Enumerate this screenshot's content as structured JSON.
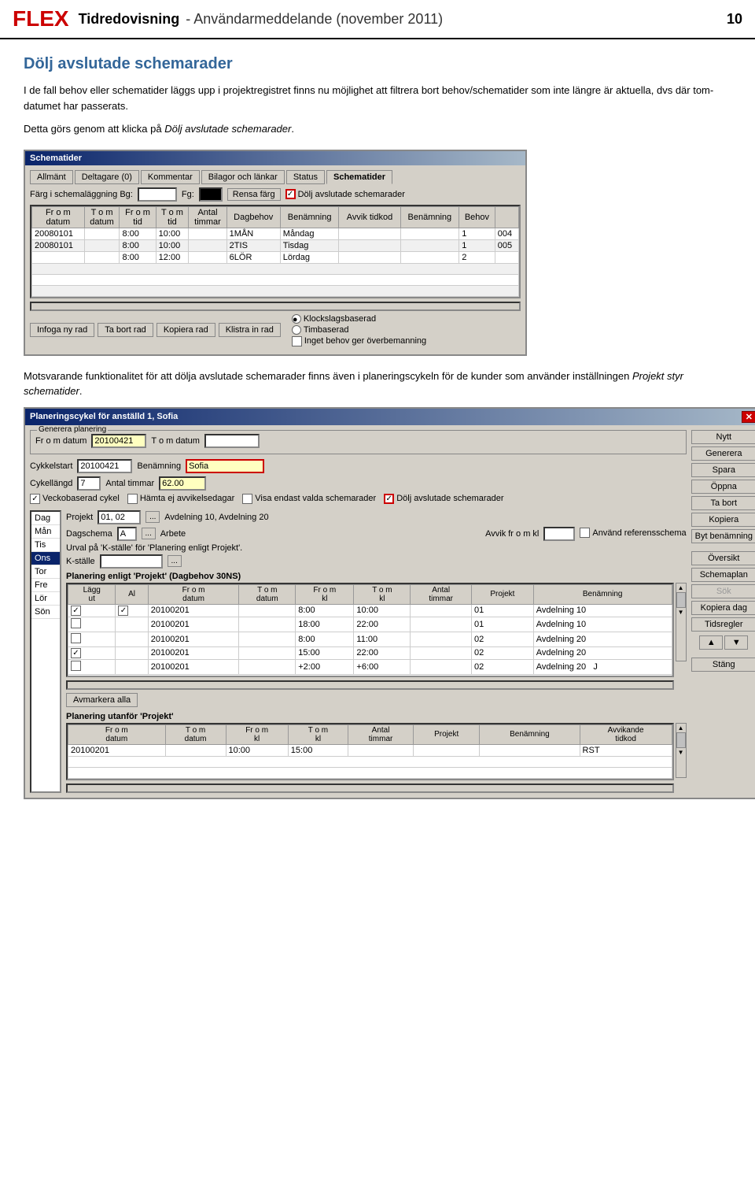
{
  "header": {
    "logo": "FLEX",
    "title": "Tidredovisning",
    "subtitle": "- Användarmeddelande (november 2011)",
    "page": "10"
  },
  "section1": {
    "title": "Dölj avslutade schemarader",
    "para1": "I de fall behov eller schematider läggs upp i projektregistret finns nu möjlighet att filtrera bort behov/schematider som inte längre är aktuella, dvs där tom-datumet har passerats.",
    "para2_prefix": "Detta görs genom att klicka på ",
    "para2_italic": "Dölj avslutade schemarader",
    "para2_suffix": "."
  },
  "schemaWindow": {
    "tabs": [
      "Allmänt",
      "Deltagare (0)",
      "Kommentar",
      "Bilagor och länkar",
      "Status",
      "Schematider"
    ],
    "activeTab": "Schematider",
    "filterRow": {
      "label": "Färg i schemaläggning Bg:",
      "fgLabel": "Fg:",
      "clearBtn": "Rensa färg",
      "checkboxLabel": "Dölj avslutade schemarader"
    },
    "tableHeaders": [
      "Fr o m\ndatum",
      "T o m\ndatum",
      "Fr o m\ntid",
      "T o m\ntid",
      "Antal\ntimmar",
      "Dagbehov",
      "Benämning",
      "Avvik tidkod",
      "Benämning",
      "Behov",
      ""
    ],
    "tableRows": [
      [
        "20080101",
        "",
        "8:00",
        "10:00",
        "",
        "1MÅN",
        "Måndag",
        "",
        "",
        "1",
        "004"
      ],
      [
        "20080101",
        "",
        "8:00",
        "10:00",
        "",
        "2TIS",
        "Tisdag",
        "",
        "",
        "1",
        "005"
      ],
      [
        "",
        "",
        "8:00",
        "12:00",
        "",
        "6LÖR",
        "Lördag",
        "",
        "",
        "2",
        ""
      ]
    ],
    "buttons": [
      "Infoga ny rad",
      "Ta bort rad",
      "Kopiera rad",
      "Klistra in rad"
    ],
    "radioOptions": [
      "Klockslagsbaserad",
      "Timbaserad"
    ],
    "selectedRadio": "Klockslagsbaserad",
    "checkboxExtra": "Inget behov ger överbemanning"
  },
  "section2": {
    "para1": "Motsvarande funktionalitet för att dölja avslutade schemarader finns även i planeringscykeln för de kunder som använder inställningen ",
    "italic": "Projekt styr schematider",
    "para1_suffix": "."
  },
  "planWindow": {
    "title": "Planeringscykel för anställd 1, Sofia",
    "closeBtn": "✕",
    "generateGroup": {
      "label": "Generera planering",
      "fromLabel": "Fr o m datum",
      "fromValue": "20100421",
      "tomLabel": "T o m datum",
      "tomValue": ""
    },
    "cyckelStart": {
      "label": "Cykkelstart",
      "value": "20100421",
      "benLabel": "Benämning",
      "benValue": "Sofia"
    },
    "cyckelLangd": {
      "label": "Cykellängd",
      "value": "7",
      "antLabel": "Antal timmar",
      "antValue": "62.00"
    },
    "checkboxes": [
      {
        "label": "Veckobaserad cykel",
        "checked": true
      },
      {
        "label": "Hämta ej avvikelsedagar",
        "checked": false
      },
      {
        "label": "Visa endast valda schemarader",
        "checked": false
      },
      {
        "label": "Dölj avslutade schemarader",
        "checked": true
      }
    ],
    "days": [
      "Dag",
      "Mån",
      "Tis",
      "Ons",
      "Tor",
      "Fre",
      "Lör",
      "Sön"
    ],
    "selectedDay": "Ons",
    "projectRow": {
      "label": "Projekt",
      "value": "01, 02",
      "avdLabel": "Avdelning 10, Avdelning 20"
    },
    "dagschemaRow": {
      "label": "Dagschema",
      "value": "A",
      "workLabel": "Arbete",
      "avvLabel": "Avvik fr o m kl",
      "avvValue": "",
      "refLabel": "Använd referensschema",
      "refChecked": false
    },
    "urvalLabel": "Urval på 'K-ställe' för 'Planering enligt Projekt'.",
    "kstLabel": "K-ställe",
    "kstValue": "",
    "planSection": {
      "title": "Planering enligt 'Projekt' (Dagbehov 30NS)",
      "headers": [
        "Lägg ut",
        "Al",
        "Fr o m datum",
        "T o m datum",
        "Fr o m kl",
        "T o m kl",
        "Antal timmar",
        "Projekt",
        "Benämning"
      ],
      "rows": [
        {
          "checkbox": true,
          "al": true,
          "from": "20100201",
          "tom": "",
          "frkl": "8:00",
          "tokl": "10:00",
          "ant": "",
          "proj": "01",
          "ben": "Avdelning 10"
        },
        {
          "checkbox": false,
          "al": false,
          "from": "20100201",
          "tom": "",
          "frkl": "18:00",
          "tokl": "22:00",
          "ant": "",
          "proj": "01",
          "ben": "Avdelning 10"
        },
        {
          "checkbox": false,
          "al": false,
          "from": "20100201",
          "tom": "",
          "frkl": "8:00",
          "tokl": "11:00",
          "ant": "",
          "proj": "02",
          "ben": "Avdelning 20"
        },
        {
          "checkbox": true,
          "al": false,
          "from": "20100201",
          "tom": "",
          "frkl": "15:00",
          "tokl": "22:00",
          "ant": "",
          "proj": "02",
          "ben": "Avdelning 20"
        },
        {
          "checkbox": false,
          "al": false,
          "from": "20100201",
          "tom": "",
          "frkl": "+2:00",
          "tokl": "+6:00",
          "ant": "",
          "proj": "02",
          "ben": "Avdelning 20",
          "extra": "J"
        }
      ]
    },
    "avmarkera": "Avmarkera alla",
    "planUtanfor": {
      "title": "Planering utanför 'Projekt'",
      "headers": [
        "Fr o m datum",
        "T o m datum",
        "Fr o m kl",
        "T o m kl",
        "Antal timmar",
        "Projekt",
        "Benämning",
        "Avvikande tidkod"
      ],
      "rows": [
        {
          "from": "20100201",
          "tom": "",
          "frkl": "10:00",
          "tokl": "15:00",
          "ant": "",
          "proj": "",
          "ben": "",
          "avv": "RST"
        }
      ]
    },
    "sideButtons": [
      "Nytt",
      "Generera",
      "Spara",
      "Öppna",
      "Ta bort",
      "Kopiera",
      "Byt benämning",
      "Översikt",
      "Schemaplan",
      "Sök",
      "Kopiera dag",
      "Tidsregler",
      "▲",
      "▼",
      "Stäng"
    ],
    "disabledBtns": [
      "Sök"
    ]
  }
}
